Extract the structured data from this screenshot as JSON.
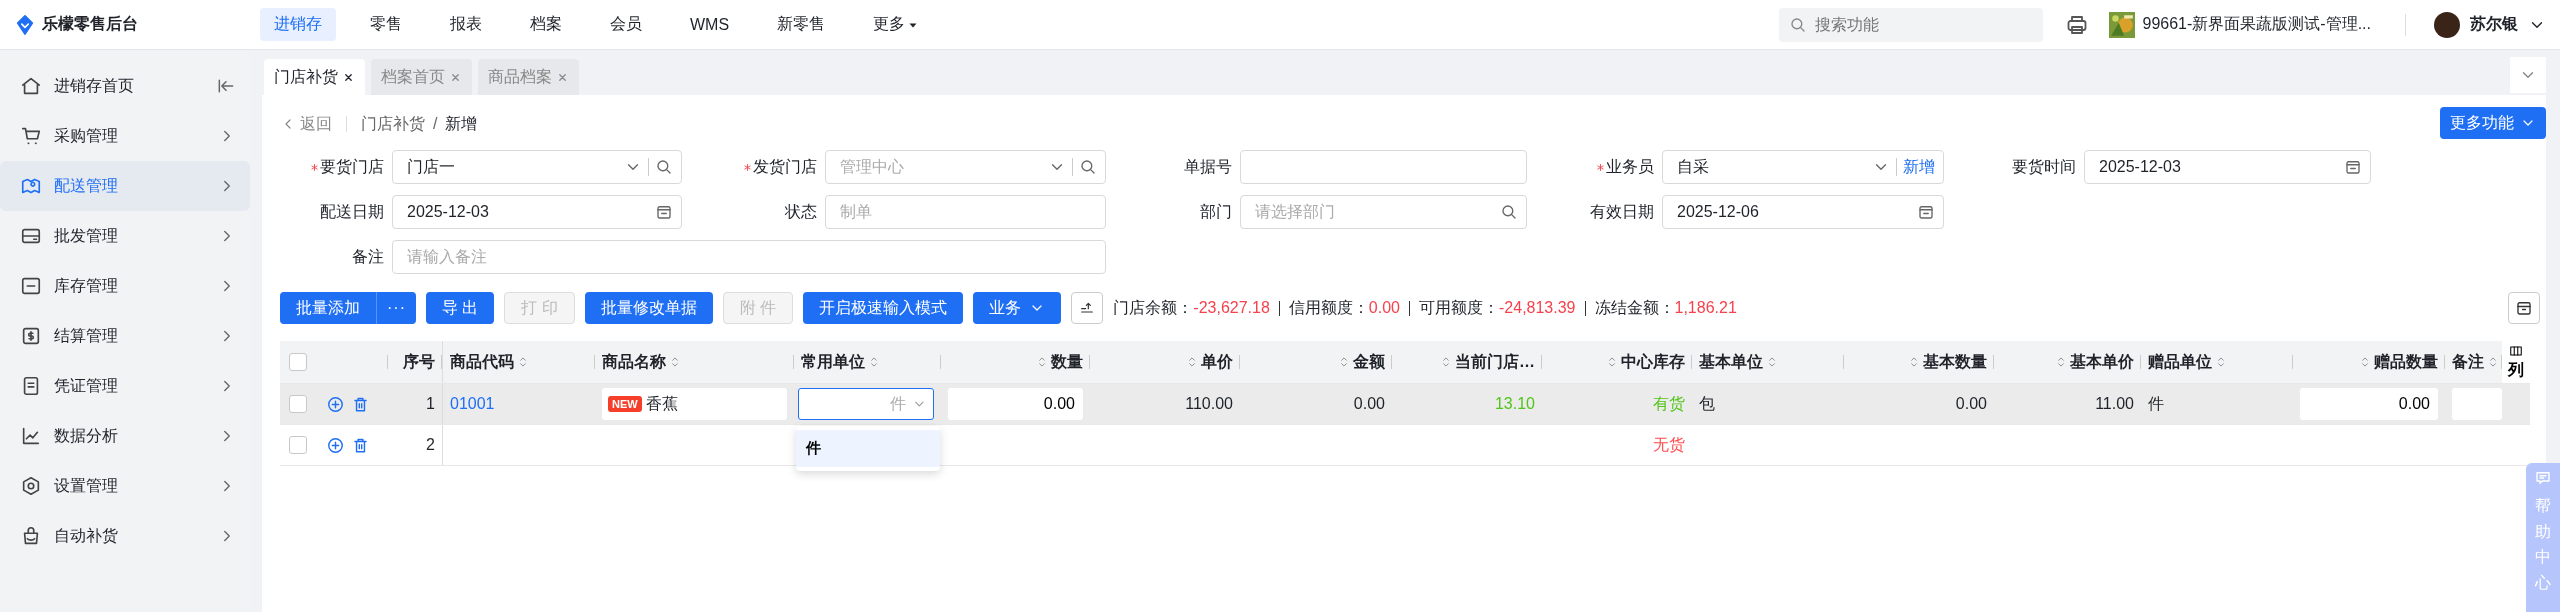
{
  "app": {
    "title": "乐檬零售后台"
  },
  "nav": [
    {
      "label": "进销存",
      "selected": true,
      "kind": "link"
    },
    {
      "label": "零售",
      "selected": false,
      "kind": "link"
    },
    {
      "label": "报表",
      "selected": false,
      "kind": "link"
    },
    {
      "label": "档案",
      "selected": false,
      "kind": "link"
    },
    {
      "label": "会员",
      "selected": false,
      "kind": "link"
    },
    {
      "label": "WMS",
      "selected": false,
      "kind": "link"
    },
    {
      "label": "新零售",
      "selected": false,
      "kind": "link"
    },
    {
      "label": "更多",
      "selected": false,
      "kind": "dropdown"
    }
  ],
  "search": {
    "placeholder": "搜索功能"
  },
  "store": {
    "name": "99661-新界面果蔬版测试-管理..."
  },
  "user": {
    "name": "苏尔银"
  },
  "sidebar": {
    "items": [
      {
        "label": "进销存首页",
        "kind": "link",
        "selected": false
      },
      {
        "label": "采购管理",
        "kind": "group",
        "selected": false
      },
      {
        "label": "配送管理",
        "kind": "group",
        "selected": true
      },
      {
        "label": "批发管理",
        "kind": "group",
        "selected": false
      },
      {
        "label": "库存管理",
        "kind": "group",
        "selected": false
      },
      {
        "label": "结算管理",
        "kind": "group",
        "selected": false
      },
      {
        "label": "凭证管理",
        "kind": "group",
        "selected": false
      },
      {
        "label": "数据分析",
        "kind": "group",
        "selected": false
      },
      {
        "label": "设置管理",
        "kind": "group",
        "selected": false
      },
      {
        "label": "自动补货",
        "kind": "group",
        "selected": false
      }
    ]
  },
  "tabs": [
    {
      "label": "门店补货",
      "selected": true
    },
    {
      "label": "档案首页",
      "selected": false
    },
    {
      "label": "商品档案",
      "selected": false
    }
  ],
  "breadcrumb": {
    "back": "返回",
    "path": [
      "门店补货",
      "新增"
    ],
    "separator": "/"
  },
  "more_button": {
    "label": "更多功能"
  },
  "form": {
    "rows": [
      [
        {
          "label": "要货门店",
          "required": true,
          "kind": "select-search",
          "value": "门店一"
        },
        {
          "label": "发货门店",
          "required": true,
          "kind": "select-search",
          "placeholder": "管理中心"
        },
        {
          "label": "单据号",
          "required": false,
          "kind": "text"
        },
        {
          "label": "业务员",
          "required": true,
          "kind": "select-add",
          "value": "自采",
          "action": "新增"
        },
        {
          "label": "要货时间",
          "required": false,
          "kind": "date",
          "value": "2025-12-03"
        }
      ],
      [
        {
          "label": "配送日期",
          "required": false,
          "kind": "date",
          "value": "2025-12-03"
        },
        {
          "label": "状态",
          "required": false,
          "kind": "text",
          "placeholder": "制单"
        },
        {
          "label": "部门",
          "required": false,
          "kind": "search",
          "placeholder": "请选择部门"
        },
        {
          "label": "有效日期",
          "required": false,
          "kind": "date",
          "value": "2025-12-06"
        }
      ],
      [
        {
          "label": "备注",
          "required": false,
          "kind": "wide",
          "placeholder": "请输入备注"
        }
      ]
    ]
  },
  "toolbar": {
    "buttons": [
      {
        "label": "批量添加",
        "kind": "split",
        "menu_label": "···",
        "disabled": false
      },
      {
        "label": "导 出",
        "kind": "plain",
        "disabled": false
      },
      {
        "label": "打 印",
        "kind": "plain",
        "disabled": true
      },
      {
        "label": "批量修改单据",
        "kind": "plain",
        "disabled": false
      },
      {
        "label": "附 件",
        "kind": "plain",
        "disabled": true
      },
      {
        "label": "开启极速输入模式",
        "kind": "plain",
        "disabled": false
      },
      {
        "label": "业务",
        "kind": "dropdown",
        "disabled": false
      }
    ],
    "balances": [
      {
        "label": "门店余额：",
        "value": "-23,627.18"
      },
      {
        "label": "信用额度：",
        "value": "0.00"
      },
      {
        "label": "可用额度：",
        "value": "-24,813.39"
      },
      {
        "label": "冻结金额：",
        "value": "1,186.21"
      }
    ]
  },
  "table": {
    "header_checked": false,
    "columns": [
      {
        "label": "序号",
        "sortable": false
      },
      {
        "label": "商品代码",
        "sortable": true
      },
      {
        "label": "商品名称",
        "sortable": true
      },
      {
        "label": "常用单位",
        "sortable": true
      },
      {
        "label": "数量",
        "sortable": true
      },
      {
        "label": "单价",
        "sortable": true
      },
      {
        "label": "金额",
        "sortable": true
      },
      {
        "label": "当前门店…",
        "sortable": true
      },
      {
        "label": "中心库存",
        "sortable": true
      },
      {
        "label": "基本单位",
        "sortable": true
      },
      {
        "label": "基本数量",
        "sortable": true
      },
      {
        "label": "基本单价",
        "sortable": true
      },
      {
        "label": "赠品单位",
        "sortable": true
      },
      {
        "label": "赠品数量",
        "sortable": true
      },
      {
        "label": "备注",
        "sortable": true
      }
    ],
    "column_settings": {
      "label": "列"
    },
    "rows": [
      {
        "selected": true,
        "checked": false,
        "seq": "1",
        "code": "01001",
        "badge": "NEW",
        "name": "香蕉",
        "unit": {
          "placeholder": "件",
          "open": true,
          "options": [
            {
              "label": "件",
              "selected": true
            }
          ]
        },
        "qty": "0.00",
        "price": "110.00",
        "amount": "0.00",
        "store_stock": "13.10",
        "stock": {
          "label": "有货",
          "color": "#52c41a"
        },
        "base_unit": "包",
        "base_qty": "0.00",
        "base_price": "11.00",
        "gift_unit": "件",
        "gift_qty": "0.00"
      },
      {
        "selected": false,
        "checked": false,
        "seq": "2",
        "stock": {
          "label": "无货",
          "color": "#ff4d4f"
        }
      }
    ]
  },
  "help": {
    "label": "帮助中心"
  }
}
